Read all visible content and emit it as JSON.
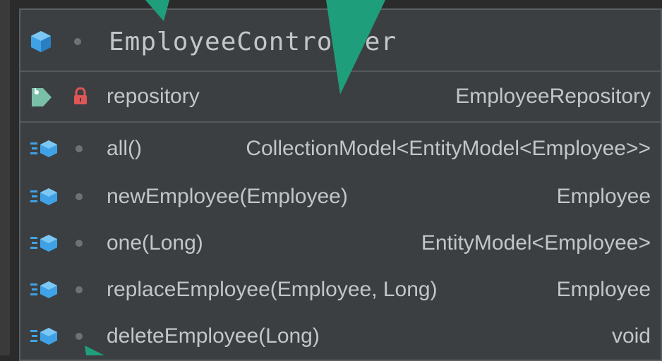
{
  "class": {
    "name": "EmployeeController",
    "icon": "class-cube-icon",
    "visibility_icon": "dot-icon"
  },
  "fields": [
    {
      "name": "repository",
      "type": "EmployeeRepository",
      "icon": "field-tag-icon",
      "visibility": "private-lock-icon"
    }
  ],
  "methods": [
    {
      "name": "all()",
      "type": "CollectionModel<EntityModel<Employee>>",
      "icon": "method-icon",
      "visibility": "dot-icon"
    },
    {
      "name": "newEmployee(Employee)",
      "type": "Employee",
      "icon": "method-icon",
      "visibility": "dot-icon"
    },
    {
      "name": "one(Long)",
      "type": "EntityModel<Employee>",
      "icon": "method-icon",
      "visibility": "dot-icon"
    },
    {
      "name": "replaceEmployee(Employee, Long)",
      "type": "Employee",
      "icon": "method-icon",
      "visibility": "dot-icon"
    },
    {
      "name": "deleteEmployee(Long)",
      "type": "void",
      "icon": "method-icon",
      "visibility": "dot-icon"
    }
  ],
  "colors": {
    "background": "#2b2b2b",
    "box": "#3c3f41",
    "text": "#c2c6c9",
    "class_icon": "#3fa2e6",
    "lock": "#e05555",
    "tag": "#7ac0a8",
    "arrow": "#1f9e7c"
  }
}
